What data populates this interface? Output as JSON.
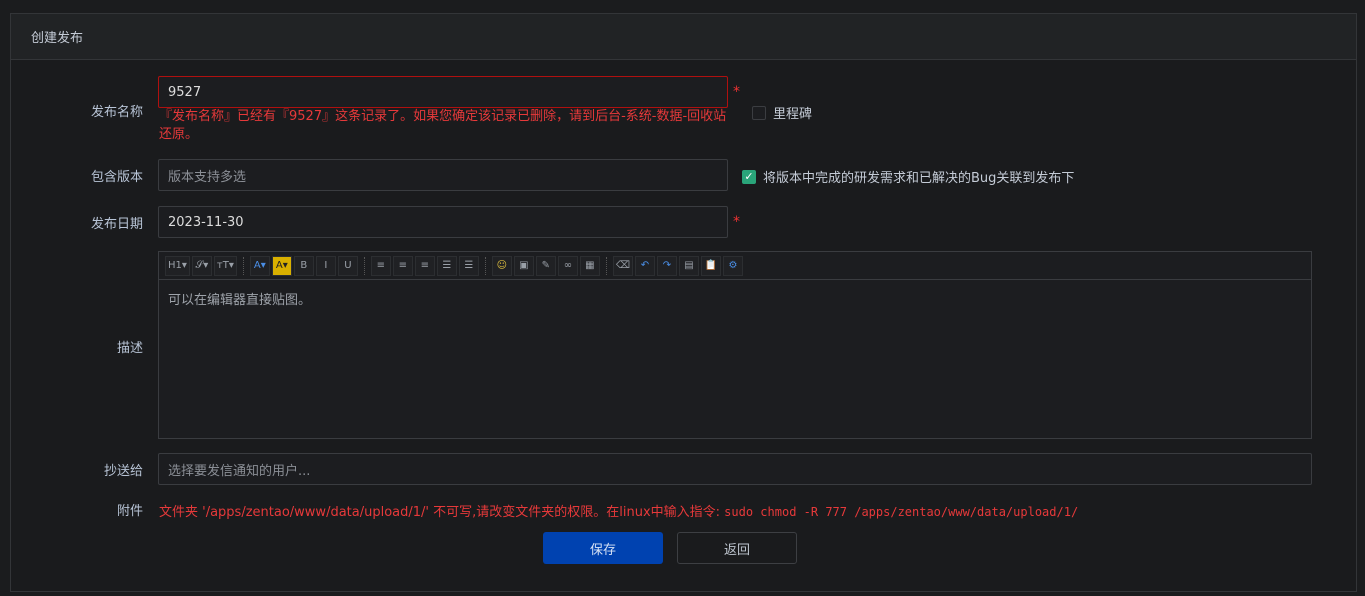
{
  "title": "创建发布",
  "fields": {
    "name": {
      "label": "发布名称",
      "value": "9527",
      "error": "『发布名称』已经有『9527』这条记录了。如果您确定该记录已删除，请到后台-系统-数据-回收站还原。"
    },
    "milestone": {
      "label": "里程碑",
      "checked": false
    },
    "builds": {
      "label": "包含版本",
      "placeholder": "版本支持多选"
    },
    "sync": {
      "label": "将版本中完成的研发需求和已解决的Bug关联到发布下",
      "checked": true
    },
    "date": {
      "label": "发布日期",
      "value": "2023-11-30"
    },
    "desc": {
      "label": "描述",
      "placeholder": "可以在编辑器直接贴图。"
    },
    "mailto": {
      "label": "抄送给",
      "placeholder": "选择要发信通知的用户..."
    },
    "files": {
      "label": "附件",
      "error": "文件夹 '/apps/zentao/www/data/upload/1/' 不可写,请改变文件夹的权限。在linux中输入指令: ",
      "command": "sudo chmod -R 777 /apps/zentao/www/data/upload/1/"
    }
  },
  "required_mark": "*",
  "toolbar": [
    {
      "icon": "heading-icon",
      "glyph": "H1▾"
    },
    {
      "icon": "font-family-icon",
      "glyph": "𝒮▾"
    },
    {
      "icon": "font-size-icon",
      "glyph": "тT▾"
    },
    {
      "sep": true
    },
    {
      "icon": "font-color-icon",
      "glyph": "A▾"
    },
    {
      "icon": "highlight-icon",
      "glyph": "A▾"
    },
    {
      "icon": "bold-icon",
      "glyph": "B"
    },
    {
      "icon": "italic-icon",
      "glyph": "I"
    },
    {
      "icon": "underline-icon",
      "glyph": "U"
    },
    {
      "sep": true
    },
    {
      "icon": "align-left-icon",
      "glyph": "≡"
    },
    {
      "icon": "align-center-icon",
      "glyph": "≡"
    },
    {
      "icon": "align-right-icon",
      "glyph": "≡"
    },
    {
      "icon": "ordered-list-icon",
      "glyph": "☰"
    },
    {
      "icon": "unordered-list-icon",
      "glyph": "☰"
    },
    {
      "sep": true
    },
    {
      "icon": "emoticon-icon",
      "glyph": "☺"
    },
    {
      "icon": "image-icon",
      "glyph": "▣"
    },
    {
      "icon": "code-icon",
      "glyph": "✎"
    },
    {
      "icon": "link-icon",
      "glyph": "∞"
    },
    {
      "icon": "table-icon",
      "glyph": "▦"
    },
    {
      "sep": true
    },
    {
      "icon": "eraser-icon",
      "glyph": "⌫"
    },
    {
      "icon": "undo-icon",
      "glyph": "↶"
    },
    {
      "icon": "redo-icon",
      "glyph": "↷"
    },
    {
      "icon": "fullscreen-icon",
      "glyph": "▤"
    },
    {
      "icon": "paste-icon",
      "glyph": "📋"
    },
    {
      "icon": "about-icon",
      "glyph": "⚙"
    }
  ],
  "buttons": {
    "save": "保存",
    "back": "返回"
  }
}
